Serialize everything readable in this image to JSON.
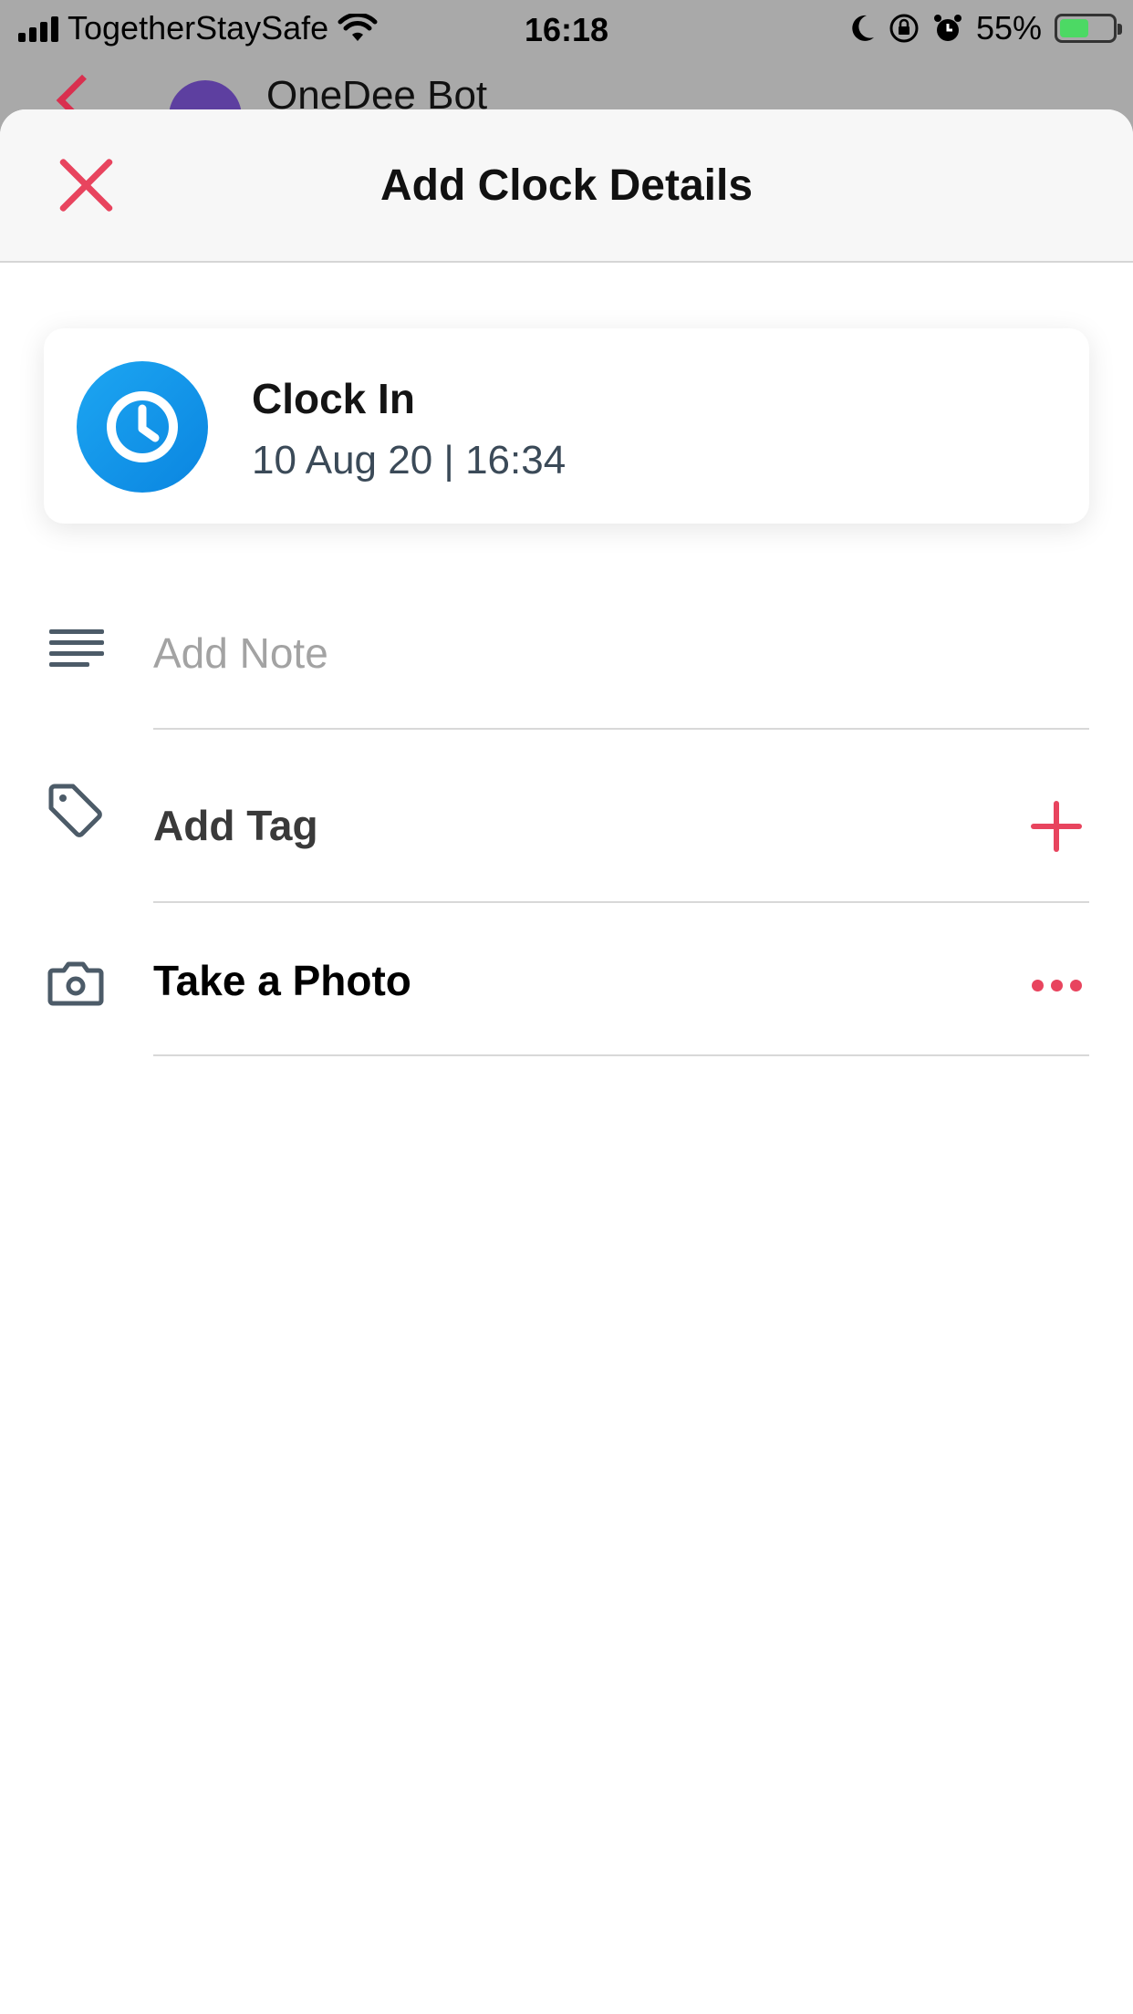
{
  "status_bar": {
    "carrier": "TogetherStaySafe",
    "time": "16:18",
    "battery": "55%",
    "battery_level": 0.55
  },
  "background_screen": {
    "title": "OneDee Bot"
  },
  "sheet": {
    "title": "Add Clock Details",
    "close_icon": "close-icon"
  },
  "clock_card": {
    "label": "Clock In",
    "datetime": "10 Aug 20 | 16:34",
    "icon": "clock-icon"
  },
  "rows": {
    "note": {
      "placeholder": "Add Note",
      "value": "",
      "icon": "notes-icon"
    },
    "tag": {
      "label": "Add Tag",
      "icon": "tag-icon",
      "action_icon": "plus-icon"
    },
    "photo": {
      "label": "Take a Photo",
      "icon": "camera-icon",
      "action_icon": "more-icon"
    }
  },
  "colors": {
    "accent": "#e8445e",
    "clock_blue": "#1da6f2",
    "tag_text": "#3a3a3a",
    "photo_text": "#000000"
  }
}
